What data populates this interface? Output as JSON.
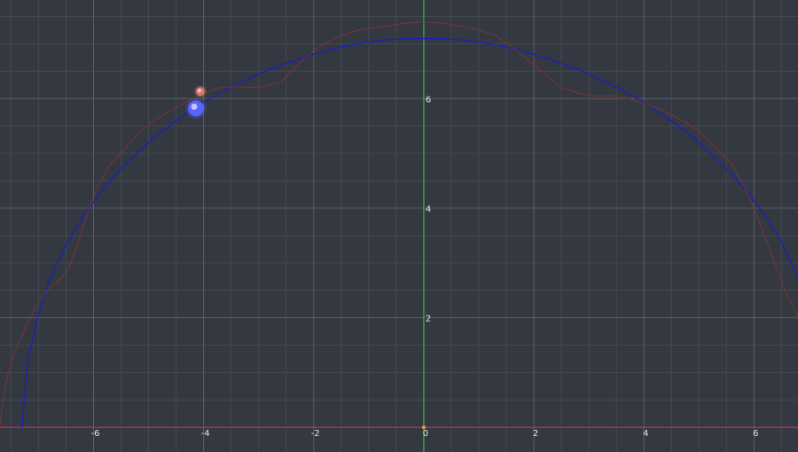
{
  "chart_data": {
    "type": "line",
    "xlim": [
      -7.7,
      6.8
    ],
    "ylim": [
      -0.45,
      7.8
    ],
    "grid": true,
    "x_ticks": [
      {
        "value": -6,
        "label": "-6"
      },
      {
        "value": -4,
        "label": "-4"
      },
      {
        "value": -2,
        "label": "-2"
      },
      {
        "value": 0,
        "label": "0"
      },
      {
        "value": 2,
        "label": "2"
      },
      {
        "value": 4,
        "label": "4"
      },
      {
        "value": 6,
        "label": "6"
      }
    ],
    "y_ticks": [
      {
        "value": 2,
        "label": "2"
      },
      {
        "value": 4,
        "label": "4"
      },
      {
        "value": 6,
        "label": "6"
      }
    ],
    "colors": {
      "background": "#343841",
      "grid_minor": "#444952",
      "grid_major": "#5a5f68",
      "x_axis": "#d0305e",
      "y_axis": "#27c43a",
      "circle": "#1a1fc0",
      "epicycle_path": "#7a3438",
      "point_blue": "#5b63ff",
      "point_red": "#d07a70",
      "origin_marker": "#e0a030"
    },
    "series": [
      {
        "key": "circle",
        "x": [
          -7.3,
          -7.2,
          -7.0,
          -6.8,
          -6.5,
          -6.2,
          -5.9,
          -5.6,
          -5.2,
          -4.8,
          -4.4,
          -4.0,
          -3.6,
          -3.2,
          -2.8,
          -2.4,
          -2.0,
          -1.6,
          -1.2,
          -0.8,
          -0.4,
          0.0,
          0.4,
          0.8,
          1.2,
          1.6,
          2.0,
          2.4,
          2.8,
          3.2,
          3.6,
          4.0,
          4.4,
          4.8,
          5.2,
          5.6,
          5.9,
          6.2,
          6.5,
          6.8
        ],
        "y": [
          0.0,
          1.2,
          2.08,
          2.69,
          3.32,
          3.84,
          4.25,
          4.62,
          5.02,
          5.37,
          5.67,
          5.93,
          6.16,
          6.36,
          6.53,
          6.68,
          6.81,
          6.92,
          7.0,
          7.06,
          7.09,
          7.1,
          7.09,
          7.06,
          7.0,
          6.92,
          6.81,
          6.68,
          6.53,
          6.36,
          6.16,
          5.93,
          5.67,
          5.37,
          5.02,
          4.62,
          4.27,
          3.87,
          3.38,
          2.73
        ]
      },
      {
        "key": "epicycle_path",
        "x": [
          -7.7,
          -7.65,
          -7.55,
          -7.4,
          -7.2,
          -7.0,
          -6.8,
          -6.6,
          -6.45,
          -6.3,
          -6.1,
          -5.9,
          -5.7,
          -5.5,
          -5.2,
          -4.9,
          -4.6,
          -4.3,
          -4.0,
          -3.7,
          -3.4,
          -3.0,
          -2.6,
          -2.2,
          -1.9,
          -1.6,
          -1.3,
          -1.0,
          -0.7,
          -0.3,
          0.0,
          0.3,
          0.7,
          1.0,
          1.3,
          1.6,
          1.9,
          2.2,
          2.5,
          2.8,
          3.1,
          3.5,
          3.9,
          4.3,
          4.7,
          5.0,
          5.3,
          5.6,
          5.8,
          6.0,
          6.15,
          6.3,
          6.45,
          6.6,
          6.8
        ],
        "y": [
          0.0,
          0.5,
          1.0,
          1.45,
          1.9,
          2.3,
          2.55,
          2.7,
          2.9,
          3.3,
          3.95,
          4.45,
          4.8,
          5.0,
          5.35,
          5.6,
          5.78,
          5.95,
          6.1,
          6.2,
          6.22,
          6.2,
          6.3,
          6.7,
          6.95,
          7.1,
          7.22,
          7.28,
          7.32,
          7.38,
          7.4,
          7.38,
          7.32,
          7.25,
          7.15,
          6.95,
          6.7,
          6.45,
          6.2,
          6.1,
          6.05,
          6.05,
          5.95,
          5.8,
          5.6,
          5.4,
          5.1,
          4.8,
          4.45,
          4.0,
          3.6,
          3.2,
          2.8,
          2.4,
          2.05
        ]
      }
    ],
    "points": [
      {
        "key": "point_blue",
        "x": -4.14,
        "y": 5.82
      },
      {
        "key": "point_red",
        "x": -4.06,
        "y": 6.13
      }
    ]
  }
}
